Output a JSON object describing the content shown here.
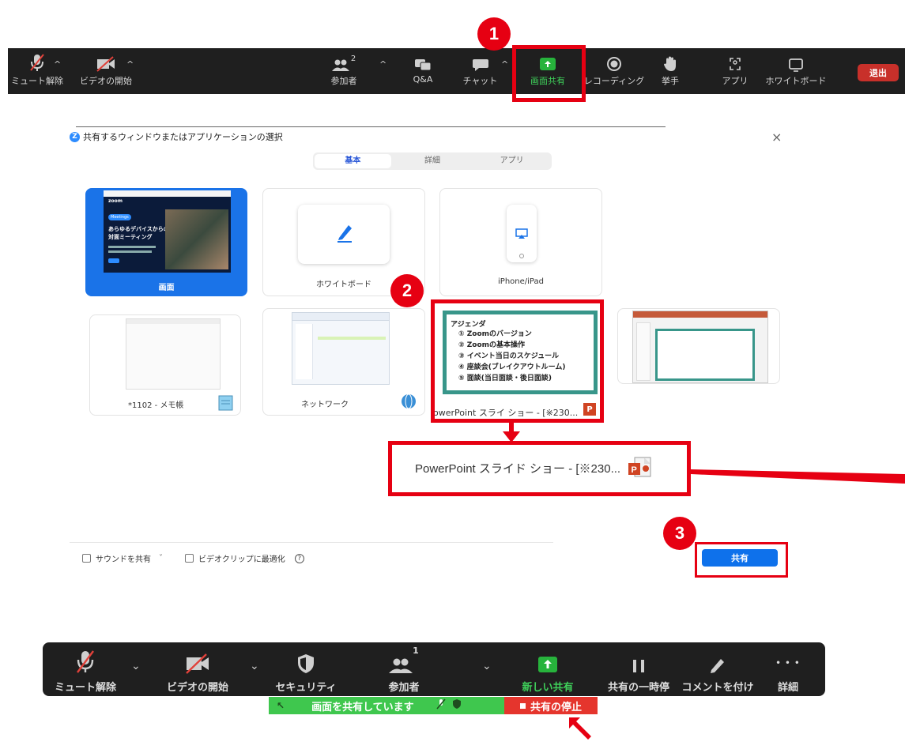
{
  "top_toolbar": {
    "mute": "ミュート解除",
    "video": "ビデオの開始",
    "participants": "参加者",
    "participants_count": "2",
    "qa": "Q&A",
    "chat": "チャット",
    "share": "画面共有",
    "record": "レコーディング",
    "raise_hand": "挙手",
    "apps": "アプリ",
    "whiteboard": "ホワイトボード",
    "exit": "退出"
  },
  "badges": {
    "one": "1",
    "two": "2",
    "three": "3"
  },
  "dialog": {
    "logo": "Z",
    "title": "共有するウィンドウまたはアプリケーションの選択",
    "close": "×",
    "tabs": [
      "基本",
      "詳細",
      "アプリ"
    ],
    "tiles": {
      "screen": "画面",
      "whiteboard": "ホワイトボード",
      "iphone": "iPhone/iPad",
      "notepad": "*1102 - メモ帳",
      "network": "ネットワーク",
      "powerpoint": "owerPoint スライ ショー - [※230..."
    },
    "screen_preview": {
      "logo": "zoom",
      "pill": "Meetings",
      "heading_1": "あらゆるデバイスからの",
      "heading_2": "対面ミーティング"
    },
    "agenda": {
      "title": "アジェンダ",
      "items": [
        "① Zoomのバージョン",
        "② Zoomの基本操作",
        "③ イベント当日のスケジュール",
        "④ 座談会(ブレイクアウトルーム)",
        "⑤ 面談(当日面談・後日面談)"
      ]
    },
    "selected_label": "PowerPoint スライド ショー - [※230...",
    "sound_share": "サウンドを共有",
    "sound_caret": "˅",
    "video_opt": "ビデオクリップに最適化",
    "help": "?",
    "share_button": "共有"
  },
  "bottom_toolbar": {
    "mute": "ミュート解除",
    "video": "ビデオの開始",
    "security": "セキュリティ",
    "participants": "参加者",
    "participants_count": "1",
    "new_share": "新しい共有",
    "pause": "共有の一時停",
    "annotate": "コメントを付け",
    "more": "詳細",
    "more_icon": "• • •"
  },
  "status_bar": {
    "sharing": "画面を共有しています",
    "stop": "共有の停止"
  },
  "colors": {
    "annotation_red": "#e60012",
    "share_green": "#3fc74e",
    "share_blue": "#0e71eb",
    "stop_red": "#e5352d"
  }
}
